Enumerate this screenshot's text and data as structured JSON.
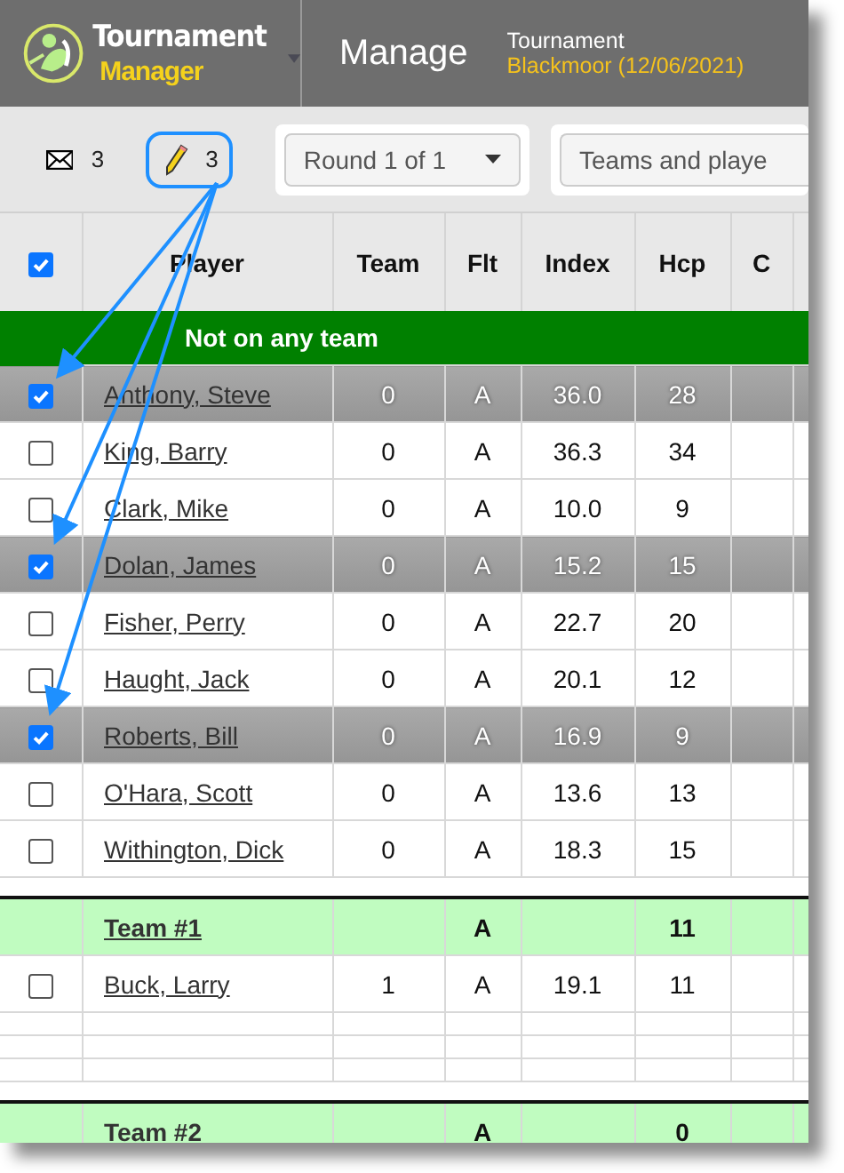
{
  "app": {
    "logo_top": "Tournament",
    "logo_bottom": "Manager",
    "section": "Manage",
    "context_label": "Tournament",
    "context_value": "Blackmoor (12/06/2021)"
  },
  "toolbar": {
    "mail_count": "3",
    "edit_count": "3",
    "round_select": "Round 1 of 1",
    "view_select": "Teams and playe"
  },
  "table": {
    "select_all": {
      "checked": true
    },
    "columns": [
      "Player",
      "Team",
      "Flt",
      "Index",
      "Hcp",
      "C"
    ],
    "rows": [
      {
        "kind": "group",
        "title": "Not on any team"
      },
      {
        "kind": "player",
        "checked": true,
        "selected": true,
        "name": "Anthony, Steve",
        "team": "0",
        "flight": "A",
        "index": "36.0",
        "hcp": "28"
      },
      {
        "kind": "player",
        "checked": false,
        "selected": false,
        "name": "King, Barry",
        "team": "0",
        "flight": "A",
        "index": "36.3",
        "hcp": "34"
      },
      {
        "kind": "player",
        "checked": false,
        "selected": false,
        "name": "Clark, Mike",
        "team": "0",
        "flight": "A",
        "index": "10.0",
        "hcp": "9"
      },
      {
        "kind": "player",
        "checked": true,
        "selected": true,
        "name": "Dolan, James",
        "team": "0",
        "flight": "A",
        "index": "15.2",
        "hcp": "15"
      },
      {
        "kind": "player",
        "checked": false,
        "selected": false,
        "name": "Fisher, Perry",
        "team": "0",
        "flight": "A",
        "index": "22.7",
        "hcp": "20"
      },
      {
        "kind": "player",
        "checked": false,
        "selected": false,
        "name": "Haught, Jack",
        "team": "0",
        "flight": "A",
        "index": "20.1",
        "hcp": "12"
      },
      {
        "kind": "player",
        "checked": true,
        "selected": true,
        "name": "Roberts, Bill",
        "team": "0",
        "flight": "A",
        "index": "16.9",
        "hcp": "9"
      },
      {
        "kind": "player",
        "checked": false,
        "selected": false,
        "name": "O'Hara, Scott",
        "team": "0",
        "flight": "A",
        "index": "13.6",
        "hcp": "13"
      },
      {
        "kind": "player",
        "checked": false,
        "selected": false,
        "name": "Withington, Dick",
        "team": "0",
        "flight": "A",
        "index": "18.3",
        "hcp": "15"
      },
      {
        "kind": "team",
        "name": "Team #1",
        "flight": "A",
        "hcp": "11"
      },
      {
        "kind": "player",
        "checked": false,
        "selected": false,
        "name": "Buck, Larry",
        "team": "1",
        "flight": "A",
        "index": "19.1",
        "hcp": "11"
      },
      {
        "kind": "blank"
      },
      {
        "kind": "blank"
      },
      {
        "kind": "blank"
      },
      {
        "kind": "team",
        "name": "Team #2",
        "flight": "A",
        "hcp": "0"
      }
    ]
  }
}
